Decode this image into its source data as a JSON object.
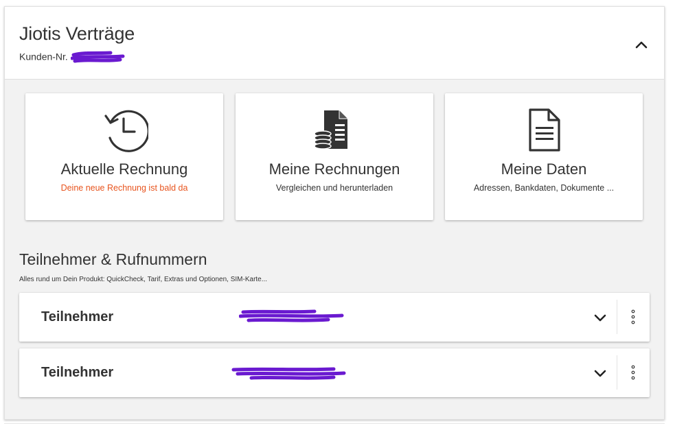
{
  "header": {
    "title": "Jiotis Verträge",
    "customer_label": "Kunden-Nr."
  },
  "tiles": [
    {
      "label": "Aktuelle Rechnung",
      "sub": "Deine neue Rechnung ist bald da",
      "icon": "clock-history-icon"
    },
    {
      "label": "Meine Rechnungen",
      "sub": "Vergleichen und herunterladen",
      "icon": "invoice-coins-icon"
    },
    {
      "label": "Meine Daten",
      "sub": "Adressen, Bankdaten, Dokumente ...",
      "icon": "document-icon"
    }
  ],
  "section": {
    "title": "Teilnehmer & Rufnummern",
    "subtitle": "Alles rund um Dein Produkt: QuickCheck, Tarif, Extras und Optionen, SIM-Karte..."
  },
  "rows": [
    {
      "label": "Teilnehmer"
    },
    {
      "label": "Teilnehmer"
    }
  ],
  "colors": {
    "alert": "#e8541e",
    "redaction": "#6a1ad0",
    "text": "#333333",
    "background": "#f2f2f2"
  }
}
